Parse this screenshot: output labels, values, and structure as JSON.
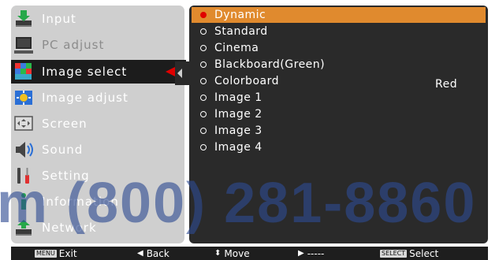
{
  "menu": {
    "items": [
      {
        "label": "Input",
        "icon": "input-arrow-icon",
        "state": "normal"
      },
      {
        "label": "PC adjust",
        "icon": "monitor-icon",
        "state": "disabled"
      },
      {
        "label": "Image select",
        "icon": "image-select-icon",
        "state": "selected"
      },
      {
        "label": "Image adjust",
        "icon": "image-adjust-icon",
        "state": "normal"
      },
      {
        "label": "Screen",
        "icon": "screen-icon",
        "state": "normal"
      },
      {
        "label": "Sound",
        "icon": "speaker-icon",
        "state": "normal"
      },
      {
        "label": "Setting",
        "icon": "tools-icon",
        "state": "normal"
      },
      {
        "label": "Information",
        "icon": "info-icon",
        "state": "normal"
      },
      {
        "label": "Network",
        "icon": "network-icon",
        "state": "normal"
      }
    ]
  },
  "options": {
    "items": [
      {
        "label": "Dynamic",
        "selected": true
      },
      {
        "label": "Standard",
        "selected": false
      },
      {
        "label": "Cinema",
        "selected": false
      },
      {
        "label": "Blackboard(Green)",
        "selected": false
      },
      {
        "label": "Colorboard",
        "selected": false
      },
      {
        "label": "Image 1",
        "selected": false
      },
      {
        "label": "Image 2",
        "selected": false
      },
      {
        "label": "Image 3",
        "selected": false
      },
      {
        "label": "Image 4",
        "selected": false
      }
    ],
    "side_value": "Red"
  },
  "bottom": {
    "exit_key": "MENU",
    "exit_label": "Exit",
    "back_label": "Back",
    "move_label": "Move",
    "next_label": "-----",
    "select_key": "SELECT",
    "select_label": "Select"
  },
  "watermark": "m (800) 281-8860",
  "colors": {
    "selection_orange": "#e08a2e",
    "arrow_red": "#e00000",
    "panel_dark": "#2a2a2a",
    "menu_gray": "#cfcfcf"
  }
}
